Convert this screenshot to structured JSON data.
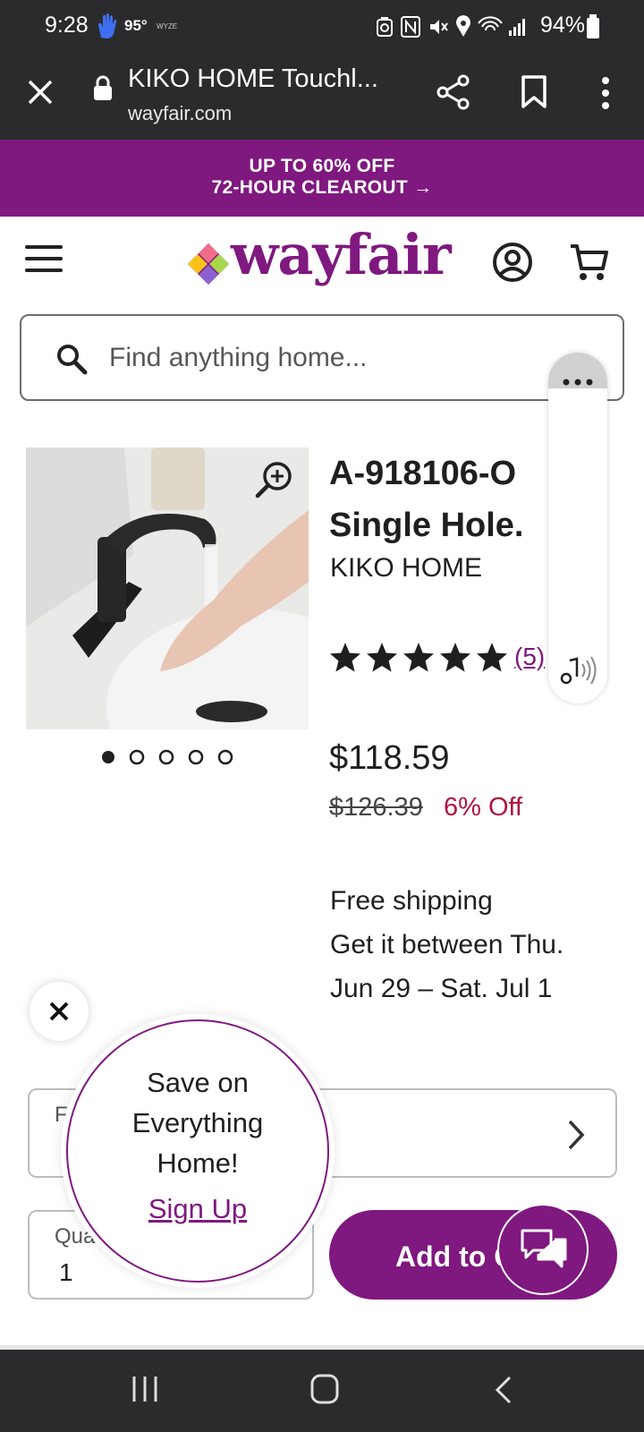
{
  "status_bar": {
    "time": "9:28",
    "temperature": "95°",
    "weather_brand": "WYZE",
    "battery": "94%"
  },
  "browser": {
    "title": "KIKO HOME Touchl...",
    "url": "wayfair.com"
  },
  "promo": {
    "line1": "UP TO 60% OFF",
    "line2": "72-HOUR CLEAROUT →"
  },
  "header": {
    "logo": "wayfair"
  },
  "search": {
    "placeholder": "Find anything home..."
  },
  "product": {
    "title_line1": "A-918106-O",
    "title_line2": "Single Hole.",
    "brand": "KIKO HOME",
    "rating": 5,
    "reviews": "(5)",
    "price": "$118.59",
    "old_price": "$126.39",
    "discount": "6% Off",
    "shipping": [
      "Free shipping",
      "Get it between Thu.",
      "Jun 29 – Sat. Jul 1"
    ],
    "image_count": 5,
    "active_image": 0
  },
  "fulfillment": {
    "label_partial": "F"
  },
  "quantity": {
    "label": "Qua",
    "value": "1"
  },
  "cart": {
    "button": "Add to C"
  },
  "popup": {
    "line1": "Save on",
    "line2": "Everything",
    "line3": "Home!",
    "signup": "Sign Up"
  },
  "colors": {
    "brand": "#7f187f",
    "discount": "#b0133d",
    "dark_bar": "#2b2b2d"
  }
}
